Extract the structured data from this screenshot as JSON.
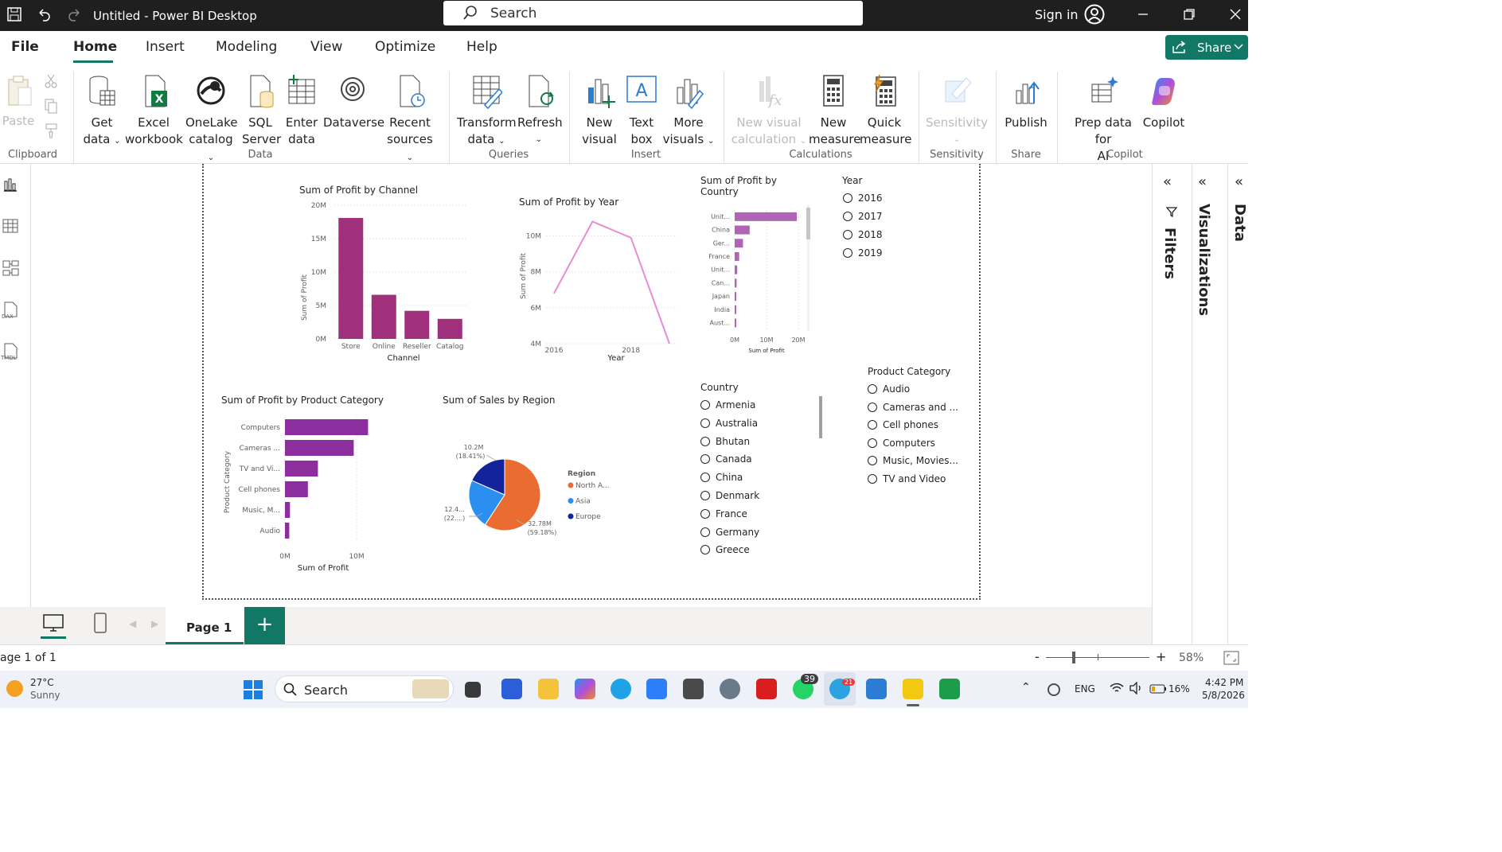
{
  "titlebar": {
    "title": "Untitled - Power BI Desktop",
    "search": "Search",
    "sign_in": "Sign in"
  },
  "menu": {
    "items": [
      "File",
      "Home",
      "Insert",
      "Modeling",
      "View",
      "Optimize",
      "Help"
    ],
    "active": "Home",
    "share": "Share"
  },
  "ribbon": {
    "clipboard": {
      "paste": "Paste",
      "group": "Clipboard"
    },
    "data": {
      "get_data": [
        "Get",
        "data"
      ],
      "excel": [
        "Excel",
        "workbook"
      ],
      "onelake": [
        "OneLake",
        "catalog"
      ],
      "sql": [
        "SQL",
        "Server"
      ],
      "enter": [
        "Enter",
        "data"
      ],
      "dataverse": "Dataverse",
      "recent": [
        "Recent",
        "sources"
      ],
      "group": "Data"
    },
    "queries": {
      "transform": [
        "Transform",
        "data"
      ],
      "refresh": "Refresh",
      "group": "Queries"
    },
    "insert": {
      "new_visual": [
        "New",
        "visual"
      ],
      "text_box": [
        "Text",
        "box"
      ],
      "more_visuals": [
        "More",
        "visuals"
      ],
      "group": "Insert"
    },
    "calculations": {
      "new_visual_calc": [
        "New visual",
        "calculation"
      ],
      "new_measure": [
        "New",
        "measure"
      ],
      "quick_measure": [
        "Quick",
        "measure"
      ],
      "group": "Calculations"
    },
    "sensitivity": {
      "label": "Sensitivity",
      "group": "Sensitivity"
    },
    "share": {
      "publish": "Publish",
      "group": "Share"
    },
    "copilot": {
      "prep": [
        "Prep data for",
        "AI"
      ],
      "copilot": "Copilot",
      "group": "Copilot"
    }
  },
  "charts": {
    "channel": {
      "title": "Sum of Profit by Channel",
      "ylabel": "Sum of Profit",
      "xlabel": "Channel",
      "yticks": [
        "20M",
        "15M",
        "10M",
        "5M",
        "0M"
      ]
    },
    "year": {
      "title": "Sum of Profit by Year",
      "ylabel": "Sum of Profit",
      "xlabel": "Year",
      "yticks": [
        "10M",
        "8M",
        "6M",
        "4M"
      ],
      "xticks": [
        "2016",
        "2018"
      ]
    },
    "country": {
      "title": [
        "Sum of Profit by",
        "Country"
      ],
      "xlabel": "Sum of Profit",
      "xticks": [
        "0M",
        "10M",
        "20M"
      ]
    },
    "category": {
      "title": "Sum of Profit by Product Category",
      "ylabel": "Product Category",
      "xlabel": "Sum of Profit",
      "xticks": [
        "0M",
        "10M"
      ]
    },
    "region": {
      "title": "Sum of Sales by Region",
      "legend_title": "Region",
      "labels": [
        [
          "10.2M",
          "(18.41%)"
        ],
        [
          "12.4...",
          "(22....)"
        ],
        [
          "32.78M",
          "(59.18%)"
        ]
      ]
    }
  },
  "chart_data": [
    {
      "type": "bar",
      "title": "Sum of Profit by Channel",
      "xlabel": "Channel",
      "ylabel": "Sum of Profit",
      "categories": [
        "Store",
        "Online",
        "Reseller",
        "Catalog"
      ],
      "values": [
        18.1,
        6.6,
        4.2,
        3.0
      ],
      "unit": "M",
      "ylim": [
        0,
        20
      ],
      "color": "#a0307b"
    },
    {
      "type": "line",
      "title": "Sum of Profit by Year",
      "xlabel": "Year",
      "ylabel": "Sum of Profit",
      "x": [
        2016,
        2017,
        2018,
        2019
      ],
      "values": [
        6.8,
        10.8,
        9.9,
        4.0
      ],
      "unit": "M",
      "ylim": [
        4,
        11
      ],
      "color": "#e98bd0"
    },
    {
      "type": "bar",
      "orientation": "horizontal",
      "title": "Sum of Profit by Country",
      "xlabel": "Sum of Profit",
      "categories": [
        "Unit...",
        "China",
        "Ger...",
        "France",
        "Unit...",
        "Can...",
        "Japan",
        "India",
        "Aust..."
      ],
      "values": [
        19.5,
        4.7,
        2.6,
        1.4,
        0.8,
        0.6,
        0.5,
        0.4,
        0.3
      ],
      "unit": "M",
      "xlim": [
        0,
        20
      ],
      "color": "#b064b5"
    },
    {
      "type": "bar",
      "orientation": "horizontal",
      "title": "Sum of Profit by Product Category",
      "xlabel": "Sum of Profit",
      "ylabel": "Product Category",
      "categories": [
        "Computers",
        "Cameras ...",
        "TV and Vi...",
        "Cell phones",
        "Music, M...",
        "Audio"
      ],
      "values": [
        11.6,
        9.6,
        4.6,
        3.2,
        0.7,
        0.6
      ],
      "unit": "M",
      "xlim": [
        0,
        10
      ],
      "color": "#8c2e9e"
    },
    {
      "type": "pie",
      "title": "Sum of Sales by Region",
      "legend_title": "Region",
      "categories": [
        "North A...",
        "Asia",
        "Europe"
      ],
      "values": [
        32.78,
        12.4,
        10.2
      ],
      "percent": [
        59.18,
        22.4,
        18.41
      ],
      "unit": "M",
      "colors": [
        "#ea6c31",
        "#2b8ff2",
        "#13239b"
      ]
    }
  ],
  "slicers": {
    "year": {
      "title": "Year",
      "items": [
        "2016",
        "2017",
        "2018",
        "2019"
      ]
    },
    "country": {
      "title": "Country",
      "items": [
        "Armenia",
        "Australia",
        "Bhutan",
        "Canada",
        "China",
        "Denmark",
        "France",
        "Germany",
        "Greece"
      ]
    },
    "category": {
      "title": "Product Category",
      "items": [
        "Audio",
        "Cameras and ...",
        "Cell phones",
        "Computers",
        "Music, Movies...",
        "TV and Video"
      ]
    }
  },
  "panes": {
    "filters": "Filters",
    "visualizations": "Visualizations",
    "data": "Data"
  },
  "pages": {
    "current": "Page 1",
    "status": "age 1 of 1",
    "zoom": "58%"
  },
  "taskbar": {
    "temp": "27°C",
    "weather": "Sunny",
    "search": "Search",
    "lang": "ENG",
    "battery": "16%",
    "time": "4:42 PM",
    "date": "5/8/2026",
    "whatsapp_badge": "39",
    "telegram_badge": "21"
  },
  "colors": {
    "accent": "#117865",
    "titlebar": "#1f1f1f"
  }
}
